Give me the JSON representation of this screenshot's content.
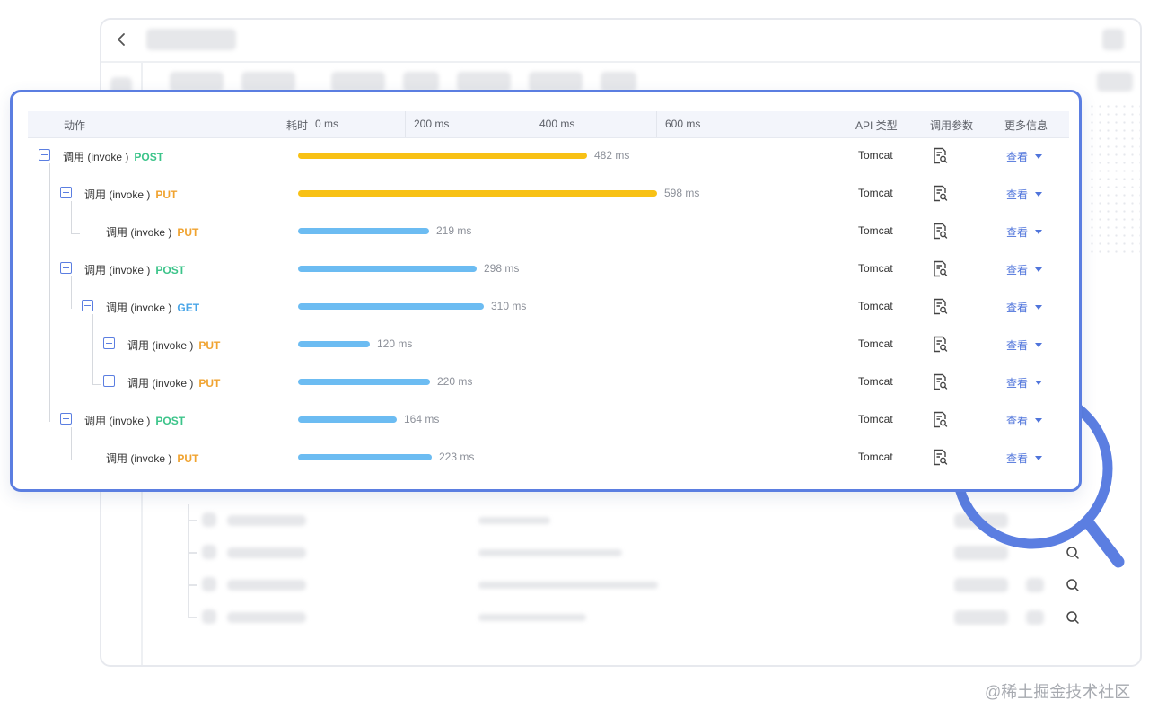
{
  "header": {
    "col_action": "动作",
    "col_time": "耗时",
    "ticks": [
      "0 ms",
      "200 ms",
      "400 ms",
      "600 ms"
    ],
    "col_api": "API 类型",
    "col_params": "调用参数",
    "col_more": "更多信息"
  },
  "rows": [
    {
      "label": "调用 (invoke )",
      "method": "POST",
      "duration": "482 ms",
      "api": "Tomcat",
      "more": "查看",
      "duration_ms": 482,
      "bar_color": "#f8c115",
      "depth": 0
    },
    {
      "label": "调用 (invoke )",
      "method": "PUT",
      "duration": "598 ms",
      "api": "Tomcat",
      "more": "查看",
      "duration_ms": 598,
      "bar_color": "#f8c115",
      "depth": 1
    },
    {
      "label": "调用 (invoke )",
      "method": "PUT",
      "duration": "219 ms",
      "api": "Tomcat",
      "more": "查看",
      "duration_ms": 219,
      "bar_color": "#6cbcf2",
      "depth": 2
    },
    {
      "label": "调用 (invoke )",
      "method": "POST",
      "duration": "298 ms",
      "api": "Tomcat",
      "more": "查看",
      "duration_ms": 298,
      "bar_color": "#6cbcf2",
      "depth": 1
    },
    {
      "label": "调用 (invoke )",
      "method": "GET",
      "duration": "310 ms",
      "api": "Tomcat",
      "more": "查看",
      "duration_ms": 310,
      "bar_color": "#6cbcf2",
      "depth": 2
    },
    {
      "label": "调用 (invoke )",
      "method": "PUT",
      "duration": "120 ms",
      "api": "Tomcat",
      "more": "查看",
      "duration_ms": 120,
      "bar_color": "#6cbcf2",
      "depth": 3
    },
    {
      "label": "调用 (invoke )",
      "method": "PUT",
      "duration": "220 ms",
      "api": "Tomcat",
      "more": "查看",
      "duration_ms": 220,
      "bar_color": "#6cbcf2",
      "depth": 3
    },
    {
      "label": "调用 (invoke )",
      "method": "POST",
      "duration": "164 ms",
      "api": "Tomcat",
      "more": "查看",
      "duration_ms": 164,
      "bar_color": "#6cbcf2",
      "depth": 1
    },
    {
      "label": "调用 (invoke )",
      "method": "PUT",
      "duration": "223 ms",
      "api": "Tomcat",
      "more": "查看",
      "duration_ms": 223,
      "bar_color": "#6cbcf2",
      "depth": 2
    }
  ],
  "icons": {
    "back": "chevron-left-icon",
    "params": "document-search-icon",
    "more": "caret-down-icon",
    "search": "search-icon",
    "magnifier": "magnifier-icon"
  },
  "colors": {
    "accent": "#5b7ee1",
    "post": "#3cc48a",
    "put": "#f0a330",
    "get": "#4aa6e8",
    "bar_highlight": "#f8c115",
    "bar_normal": "#6cbcf2"
  },
  "watermark": "@稀土掘金技术社区"
}
